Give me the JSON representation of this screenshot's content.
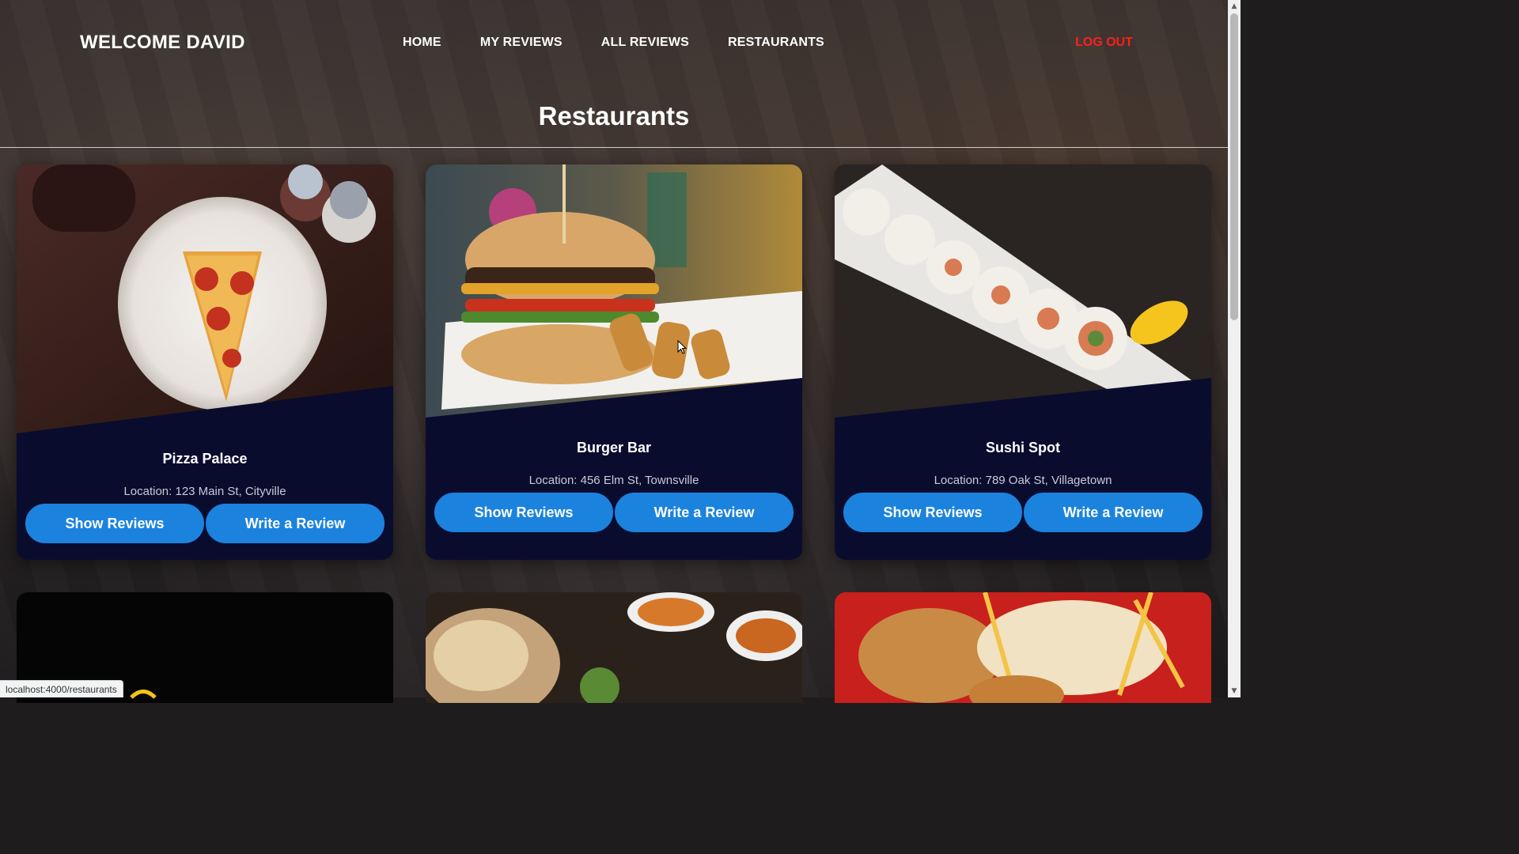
{
  "header": {
    "welcome": "WELCOME DAVID",
    "nav": [
      "HOME",
      "MY REVIEWS",
      "ALL REVIEWS",
      "RESTAURANTS"
    ],
    "logout": "LOG OUT"
  },
  "page_title": "Restaurants",
  "restaurants": [
    {
      "name": "Pizza Palace",
      "location": "Location: 123 Main St, Cityville",
      "show_label": "Show Reviews",
      "write_label": "Write a Review"
    },
    {
      "name": "Burger Bar",
      "location": "Location: 456 Elm St, Townsville",
      "show_label": "Show Reviews",
      "write_label": "Write a Review"
    },
    {
      "name": "Sushi Spot",
      "location": "Location: 789 Oak St, Villagetown",
      "show_label": "Show Reviews",
      "write_label": "Write a Review"
    }
  ],
  "status_bar": {
    "url": "localhost:4000/restaurants"
  },
  "colors": {
    "accent": "#1b83de",
    "card_bg": "#0a0c2e",
    "logout": "#ff1f1f"
  }
}
